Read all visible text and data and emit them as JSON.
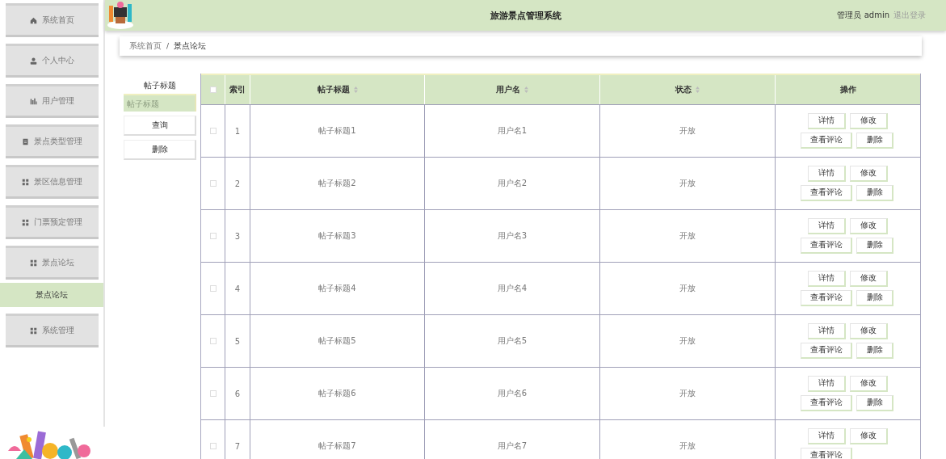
{
  "sidebar": {
    "items": [
      {
        "label": "系统首页",
        "kind": "home",
        "selected": false
      },
      {
        "label": "个人中心",
        "kind": "user",
        "selected": false
      },
      {
        "label": "用户管理",
        "kind": "chart",
        "selected": false
      },
      {
        "label": "景点类型管理",
        "kind": "doc",
        "selected": false
      },
      {
        "label": "景区信息管理",
        "kind": "grid",
        "selected": false
      },
      {
        "label": "门票预定管理",
        "kind": "grid",
        "selected": false
      },
      {
        "label": "景点论坛",
        "kind": "grid",
        "selected": false,
        "children": [
          {
            "label": "景点论坛",
            "selected": true
          }
        ]
      },
      {
        "label": "系统管理",
        "kind": "grid",
        "selected": false
      }
    ]
  },
  "header": {
    "title": "旅游景点管理系统",
    "user": "管理员 admin",
    "logout": "退出登录"
  },
  "breadcrumb": {
    "items": [
      "系统首页",
      "景点论坛"
    ],
    "separator": "/"
  },
  "search": {
    "label": "帖子标题",
    "placeholder": "帖子标题",
    "buttons": [
      "查询",
      "删除"
    ]
  },
  "table": {
    "select_all": {
      "checked": false
    },
    "columns": [
      {
        "label": "索引",
        "sortable": false
      },
      {
        "label": "帖子标题",
        "sortable": true
      },
      {
        "label": "用户名",
        "sortable": true
      },
      {
        "label": "状态",
        "sortable": true
      },
      {
        "label": "操作",
        "sortable": false
      }
    ],
    "rows": [
      {
        "checked": false,
        "index": "1",
        "title": "帖子标题1",
        "user": "用户名1",
        "status": "开放",
        "actions": [
          "详情",
          "修改",
          "查看评论",
          "删除"
        ]
      },
      {
        "checked": false,
        "index": "2",
        "title": "帖子标题2",
        "user": "用户名2",
        "status": "开放",
        "actions": [
          "详情",
          "修改",
          "查看评论",
          "删除"
        ]
      },
      {
        "checked": false,
        "index": "3",
        "title": "帖子标题3",
        "user": "用户名3",
        "status": "开放",
        "actions": [
          "详情",
          "修改",
          "查看评论",
          "删除"
        ]
      },
      {
        "checked": false,
        "index": "4",
        "title": "帖子标题4",
        "user": "用户名4",
        "status": "开放",
        "actions": [
          "详情",
          "修改",
          "查看评论",
          "删除"
        ]
      },
      {
        "checked": false,
        "index": "5",
        "title": "帖子标题5",
        "user": "用户名5",
        "status": "开放",
        "actions": [
          "详情",
          "修改",
          "查看评论",
          "删除"
        ]
      },
      {
        "checked": false,
        "index": "6",
        "title": "帖子标题6",
        "user": "用户名6",
        "status": "开放",
        "actions": [
          "详情",
          "修改",
          "查看评论",
          "删除"
        ]
      },
      {
        "checked": false,
        "index": "7",
        "title": "帖子标题7",
        "user": "用户名7",
        "status": "开放",
        "actions": [
          "详情",
          "修改",
          "查看评论"
        ]
      }
    ]
  }
}
